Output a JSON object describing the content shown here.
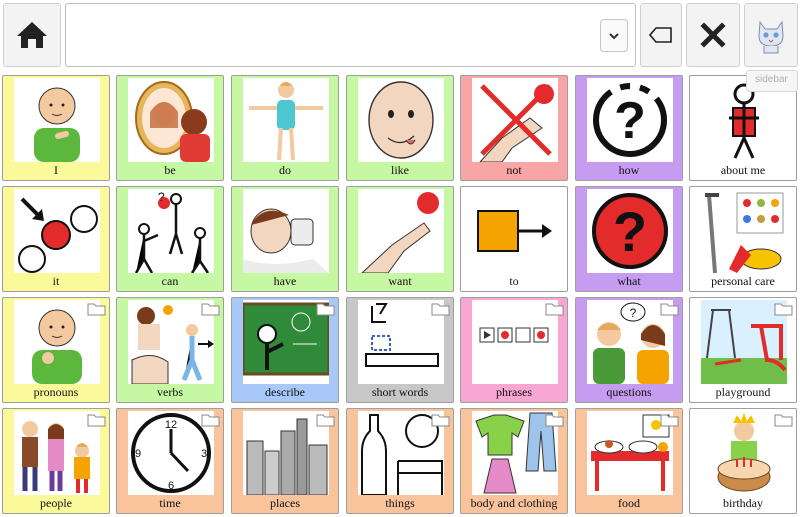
{
  "toolbar": {
    "home_icon": "home-icon",
    "dropdown_icon": "chevron-down-icon",
    "backspace_icon": "backspace-icon",
    "clear_icon": "close-icon",
    "settings_icon": "cat-icon",
    "sidebar_label": "sidebar"
  },
  "sentence": {
    "text": ""
  },
  "colors": {
    "yellow": "#fbfa9a",
    "green": "#c6f7a3",
    "red": "#f8a5a5",
    "purple": "#c69cf0",
    "white": "#ffffff",
    "blue": "#a8c8f8",
    "grey": "#c7c7c7",
    "pink": "#f8a6d2",
    "orange": "#f9c49b"
  },
  "grid": {
    "rows": [
      [
        {
          "label": "I",
          "color": "yellow",
          "folder": false,
          "icon": "person-pointing-self-icon"
        },
        {
          "label": "be",
          "color": "green",
          "folder": false,
          "icon": "mirror-icon"
        },
        {
          "label": "do",
          "color": "green",
          "folder": false,
          "icon": "person-arms-out-icon"
        },
        {
          "label": "like",
          "color": "green",
          "folder": false,
          "icon": "face-licking-icon"
        },
        {
          "label": "not",
          "color": "red",
          "folder": false,
          "icon": "hand-cross-icon"
        },
        {
          "label": "how",
          "color": "purple",
          "folder": false,
          "icon": "question-mark-dashed-icon"
        },
        {
          "label": "about me",
          "color": "white",
          "folder": false,
          "icon": "stick-figure-icon"
        }
      ],
      [
        {
          "label": "it",
          "color": "yellow",
          "folder": false,
          "icon": "arrow-circles-icon"
        },
        {
          "label": "can",
          "color": "green",
          "folder": false,
          "icon": "stick-figures-ball-icon"
        },
        {
          "label": "have",
          "color": "green",
          "folder": false,
          "icon": "boy-drinking-icon"
        },
        {
          "label": "want",
          "color": "green",
          "folder": false,
          "icon": "hand-reaching-ball-icon"
        },
        {
          "label": "to",
          "color": "white",
          "folder": false,
          "icon": "square-arrow-icon"
        },
        {
          "label": "what",
          "color": "purple",
          "folder": false,
          "icon": "question-mark-icon"
        },
        {
          "label": "personal care",
          "color": "white",
          "folder": false,
          "icon": "crutch-switch-icon"
        }
      ],
      [
        {
          "label": "pronouns",
          "color": "yellow",
          "folder": true,
          "icon": "person-pointing-icon"
        },
        {
          "label": "verbs",
          "color": "green",
          "folder": true,
          "icon": "actions-icon"
        },
        {
          "label": "describe",
          "color": "blue",
          "folder": true,
          "icon": "blackboard-icon"
        },
        {
          "label": "short words",
          "color": "grey",
          "folder": true,
          "icon": "short-words-icon"
        },
        {
          "label": "phrases",
          "color": "pink",
          "folder": true,
          "icon": "phrase-strip-icon"
        },
        {
          "label": "questions",
          "color": "purple",
          "folder": true,
          "icon": "two-people-talking-icon"
        },
        {
          "label": "playground",
          "color": "white",
          "folder": true,
          "icon": "playground-icon"
        }
      ],
      [
        {
          "label": "people",
          "color": "yellow",
          "folder": true,
          "icon": "family-icon"
        },
        {
          "label": "time",
          "color": "orange",
          "folder": true,
          "icon": "clock-icon"
        },
        {
          "label": "places",
          "color": "orange",
          "folder": true,
          "icon": "city-icon"
        },
        {
          "label": "things",
          "color": "orange",
          "folder": true,
          "icon": "bottle-ball-chair-icon"
        },
        {
          "label": "body and clothing",
          "color": "orange",
          "folder": true,
          "icon": "clothes-icon"
        },
        {
          "label": "food",
          "color": "orange",
          "folder": true,
          "icon": "table-food-icon"
        },
        {
          "label": "birthday",
          "color": "white",
          "folder": true,
          "icon": "birthday-cake-icon"
        }
      ]
    ]
  }
}
